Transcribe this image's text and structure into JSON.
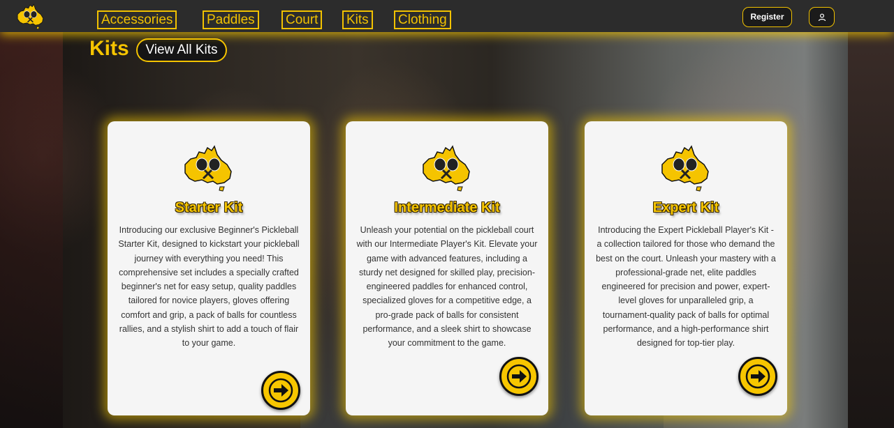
{
  "nav": {
    "items": [
      "Accessories",
      "Paddles",
      "Court",
      "Kits",
      "Clothing"
    ],
    "register_label": "Register"
  },
  "section": {
    "title": "Kits",
    "view_all_label": "View All Kits"
  },
  "kits": [
    {
      "title": "Starter Kit",
      "description": "Introducing our exclusive Beginner's Pickleball Starter Kit, designed to kickstart your pickleball journey with everything you need! This comprehensive set includes a specially crafted beginner's net for easy setup, quality paddles tailored for novice players, gloves offering comfort and grip, a pack of balls for countless rallies, and a stylish shirt to add a touch of flair to your game."
    },
    {
      "title": "Intermediate Kit",
      "description": "Unleash your potential on the pickleball court with our Intermediate Player's Kit. Elevate your game with advanced features, including a sturdy net designed for skilled play, precision-engineered paddles for enhanced control, specialized gloves for a competitive edge, a pro-grade pack of balls for consistent performance, and a sleek shirt to showcase your commitment to the game."
    },
    {
      "title": "Expert Kit",
      "description": "Introducing the Expert Pickleball Player's Kit - a collection tailored for those who demand the best on the court. Unleash your mastery with a professional-grade net, elite paddles engineered for precision and power, expert-level gloves for unparalleled grip, a tournament-quality pack of balls for optimal performance, and a high-performance shirt designed for top-tier play."
    }
  ],
  "icons": {
    "logo": "australia-pickleball-logo-icon",
    "user": "user-icon",
    "arrow": "arrow-right-icon"
  },
  "colors": {
    "accent": "#f5c400",
    "header_bg": "#2c2c2c",
    "card_bg": "#f5f5f5"
  }
}
